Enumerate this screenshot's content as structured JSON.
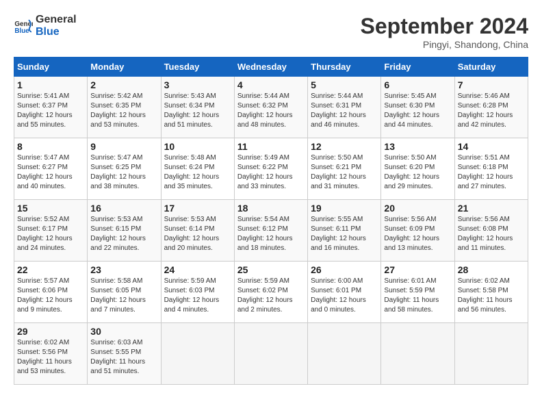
{
  "header": {
    "logo_line1": "General",
    "logo_line2": "Blue",
    "month": "September 2024",
    "location": "Pingyi, Shandong, China"
  },
  "weekdays": [
    "Sunday",
    "Monday",
    "Tuesday",
    "Wednesday",
    "Thursday",
    "Friday",
    "Saturday"
  ],
  "weeks": [
    [
      {
        "day": "1",
        "sunrise": "5:41 AM",
        "sunset": "6:37 PM",
        "daylight": "12 hours and 55 minutes."
      },
      {
        "day": "2",
        "sunrise": "5:42 AM",
        "sunset": "6:35 PM",
        "daylight": "12 hours and 53 minutes."
      },
      {
        "day": "3",
        "sunrise": "5:43 AM",
        "sunset": "6:34 PM",
        "daylight": "12 hours and 51 minutes."
      },
      {
        "day": "4",
        "sunrise": "5:44 AM",
        "sunset": "6:32 PM",
        "daylight": "12 hours and 48 minutes."
      },
      {
        "day": "5",
        "sunrise": "5:44 AM",
        "sunset": "6:31 PM",
        "daylight": "12 hours and 46 minutes."
      },
      {
        "day": "6",
        "sunrise": "5:45 AM",
        "sunset": "6:30 PM",
        "daylight": "12 hours and 44 minutes."
      },
      {
        "day": "7",
        "sunrise": "5:46 AM",
        "sunset": "6:28 PM",
        "daylight": "12 hours and 42 minutes."
      }
    ],
    [
      {
        "day": "8",
        "sunrise": "5:47 AM",
        "sunset": "6:27 PM",
        "daylight": "12 hours and 40 minutes."
      },
      {
        "day": "9",
        "sunrise": "5:47 AM",
        "sunset": "6:25 PM",
        "daylight": "12 hours and 38 minutes."
      },
      {
        "day": "10",
        "sunrise": "5:48 AM",
        "sunset": "6:24 PM",
        "daylight": "12 hours and 35 minutes."
      },
      {
        "day": "11",
        "sunrise": "5:49 AM",
        "sunset": "6:22 PM",
        "daylight": "12 hours and 33 minutes."
      },
      {
        "day": "12",
        "sunrise": "5:50 AM",
        "sunset": "6:21 PM",
        "daylight": "12 hours and 31 minutes."
      },
      {
        "day": "13",
        "sunrise": "5:50 AM",
        "sunset": "6:20 PM",
        "daylight": "12 hours and 29 minutes."
      },
      {
        "day": "14",
        "sunrise": "5:51 AM",
        "sunset": "6:18 PM",
        "daylight": "12 hours and 27 minutes."
      }
    ],
    [
      {
        "day": "15",
        "sunrise": "5:52 AM",
        "sunset": "6:17 PM",
        "daylight": "12 hours and 24 minutes."
      },
      {
        "day": "16",
        "sunrise": "5:53 AM",
        "sunset": "6:15 PM",
        "daylight": "12 hours and 22 minutes."
      },
      {
        "day": "17",
        "sunrise": "5:53 AM",
        "sunset": "6:14 PM",
        "daylight": "12 hours and 20 minutes."
      },
      {
        "day": "18",
        "sunrise": "5:54 AM",
        "sunset": "6:12 PM",
        "daylight": "12 hours and 18 minutes."
      },
      {
        "day": "19",
        "sunrise": "5:55 AM",
        "sunset": "6:11 PM",
        "daylight": "12 hours and 16 minutes."
      },
      {
        "day": "20",
        "sunrise": "5:56 AM",
        "sunset": "6:09 PM",
        "daylight": "12 hours and 13 minutes."
      },
      {
        "day": "21",
        "sunrise": "5:56 AM",
        "sunset": "6:08 PM",
        "daylight": "12 hours and 11 minutes."
      }
    ],
    [
      {
        "day": "22",
        "sunrise": "5:57 AM",
        "sunset": "6:06 PM",
        "daylight": "12 hours and 9 minutes."
      },
      {
        "day": "23",
        "sunrise": "5:58 AM",
        "sunset": "6:05 PM",
        "daylight": "12 hours and 7 minutes."
      },
      {
        "day": "24",
        "sunrise": "5:59 AM",
        "sunset": "6:03 PM",
        "daylight": "12 hours and 4 minutes."
      },
      {
        "day": "25",
        "sunrise": "5:59 AM",
        "sunset": "6:02 PM",
        "daylight": "12 hours and 2 minutes."
      },
      {
        "day": "26",
        "sunrise": "6:00 AM",
        "sunset": "6:01 PM",
        "daylight": "12 hours and 0 minutes."
      },
      {
        "day": "27",
        "sunrise": "6:01 AM",
        "sunset": "5:59 PM",
        "daylight": "11 hours and 58 minutes."
      },
      {
        "day": "28",
        "sunrise": "6:02 AM",
        "sunset": "5:58 PM",
        "daylight": "11 hours and 56 minutes."
      }
    ],
    [
      {
        "day": "29",
        "sunrise": "6:02 AM",
        "sunset": "5:56 PM",
        "daylight": "11 hours and 53 minutes."
      },
      {
        "day": "30",
        "sunrise": "6:03 AM",
        "sunset": "5:55 PM",
        "daylight": "11 hours and 51 minutes."
      },
      null,
      null,
      null,
      null,
      null
    ]
  ]
}
